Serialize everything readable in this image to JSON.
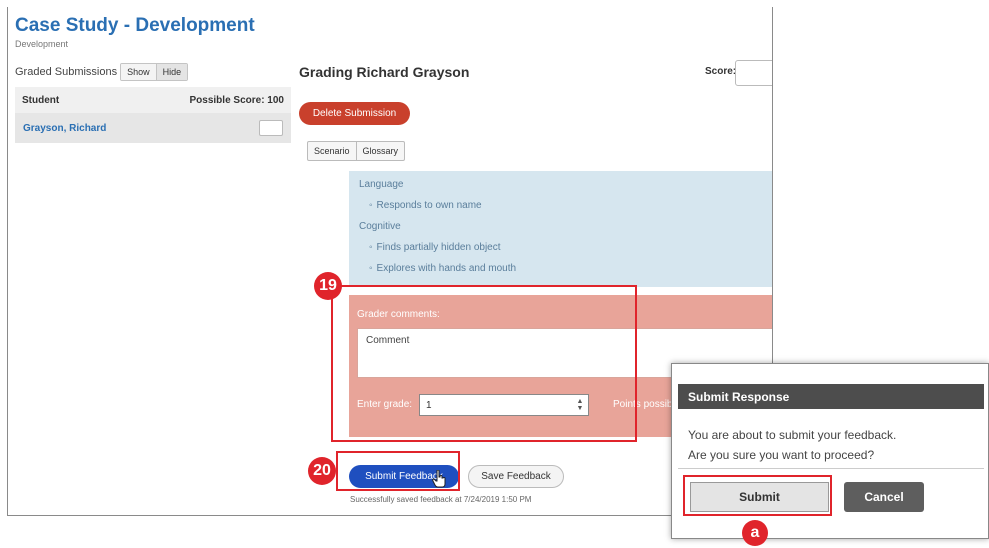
{
  "header": {
    "title": "Case Study - Development",
    "subtitle": "Development"
  },
  "sidebar": {
    "graded_label": "Graded Submissions",
    "show_label": "Show",
    "hide_label": "Hide",
    "col_student": "Student",
    "col_possible": "Possible Score: 100",
    "students": [
      {
        "name": "Grayson, Richard"
      }
    ]
  },
  "grading": {
    "title": "Grading Richard Grayson",
    "score_label": "Score:",
    "delete_label": "Delete Submission",
    "tabs": [
      "Scenario",
      "Glossary"
    ]
  },
  "milestones": {
    "cat1": "Language",
    "cat1_items": [
      "Responds to own name"
    ],
    "cat2": "Cognitive",
    "cat2_items": [
      "Finds partially hidden object",
      "Explores with hands and mouth"
    ]
  },
  "feedback": {
    "grader_label": "Grader comments:",
    "comment": "Comment",
    "grade_label": "Enter grade:",
    "grade_value": "1",
    "points_label": "Points possib"
  },
  "actions": {
    "submit_label": "Submit Feedback",
    "save_label": "Save Feedback",
    "saved_text": "Successfully saved feedback at 7/24/2019 1:50 PM"
  },
  "dialog": {
    "title": "Submit Response",
    "line1": "You are about to submit your feedback.",
    "line2": "Are you sure you want to proceed?",
    "submit": "Submit",
    "cancel": "Cancel"
  },
  "annotations": {
    "step19": "19",
    "step20": "20",
    "step_a": "a",
    "highlight_color": "#e0242b"
  }
}
